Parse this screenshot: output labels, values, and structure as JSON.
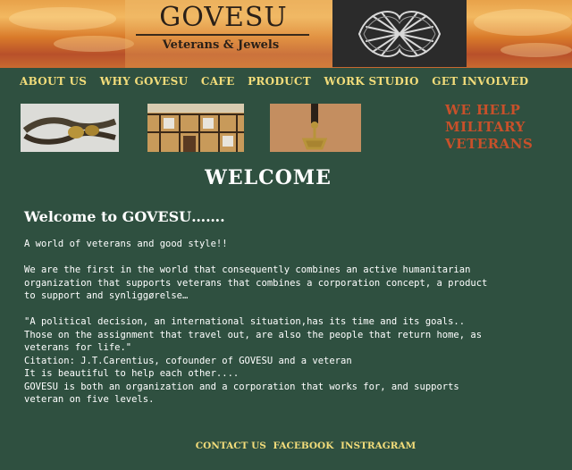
{
  "header": {
    "brand_name": "GOVESU",
    "tagline": "Veterans & Jewels"
  },
  "nav": {
    "items": [
      "About us",
      "Why GOVESU",
      "Cafe",
      "Product",
      "Work Studio",
      "Get Involved"
    ]
  },
  "promo": {
    "slogan_lines": [
      "We help",
      "military",
      "veterans"
    ]
  },
  "main": {
    "heading": "Welcome",
    "subheading": "Welcome to GOVESU…….",
    "intro": "A world of veterans and good style!!",
    "paragraph_lines": [
      "We are the first in the world that consequently combines an active humanitarian",
      "organization that supports veterans that combines a corporation concept, a product",
      "to support and synliggørelse…"
    ],
    "quote_lines": [
      "\"A political decision, an international situation,has its time and its goals..",
      "Those on the assignment that travel out,  are also the people that return home, as",
      "veterans for life.\"",
      "Citation: J.T.Carentius, cofounder of GOVESU and a veteran",
      "It is beautiful to help each other....",
      "GOVESU is  both an organization and a corporation that works for, and supports",
      "veteran on five levels."
    ]
  },
  "footer": {
    "links": [
      "Contact us",
      "Facebook",
      "Instragram"
    ]
  },
  "colors": {
    "background": "#2f5040",
    "nav_text": "#f2dc7a",
    "slogan": "#c8502a",
    "body_text": "#ffffff"
  }
}
